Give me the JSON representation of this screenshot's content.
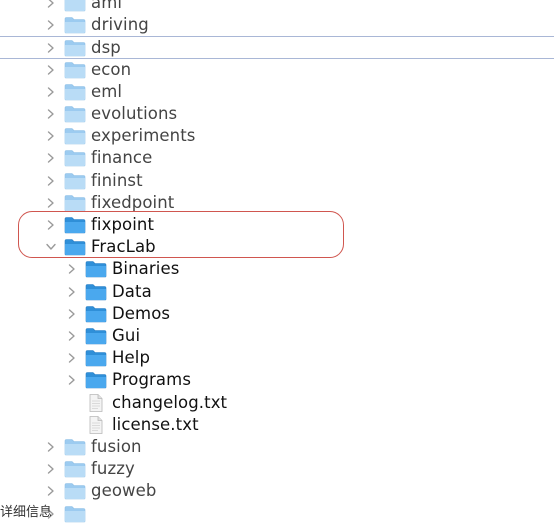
{
  "tree": {
    "items": [
      {
        "label": "aml",
        "level": 0,
        "state": "collapsed",
        "type": "folder",
        "style": "partial"
      },
      {
        "label": "driving",
        "level": 0,
        "state": "collapsed",
        "type": "folder",
        "style": "normal"
      },
      {
        "label": "dsp",
        "level": 0,
        "state": "collapsed",
        "type": "folder",
        "style": "normal"
      },
      {
        "label": "econ",
        "level": 0,
        "state": "collapsed",
        "type": "folder",
        "style": "normal"
      },
      {
        "label": "eml",
        "level": 0,
        "state": "collapsed",
        "type": "folder",
        "style": "normal"
      },
      {
        "label": "evolutions",
        "level": 0,
        "state": "collapsed",
        "type": "folder",
        "style": "normal"
      },
      {
        "label": "experiments",
        "level": 0,
        "state": "collapsed",
        "type": "folder",
        "style": "normal"
      },
      {
        "label": "finance",
        "level": 0,
        "state": "collapsed",
        "type": "folder",
        "style": "normal"
      },
      {
        "label": "fininst",
        "level": 0,
        "state": "collapsed",
        "type": "folder",
        "style": "normal"
      },
      {
        "label": "fixedpoint",
        "level": 0,
        "state": "collapsed",
        "type": "folder",
        "style": "normal"
      },
      {
        "label": "fixpoint",
        "level": 0,
        "state": "collapsed",
        "type": "folder",
        "style": "strong"
      },
      {
        "label": "FracLab",
        "level": 0,
        "state": "expanded",
        "type": "folder",
        "style": "strong"
      },
      {
        "label": "Binaries",
        "level": 1,
        "state": "collapsed",
        "type": "folder",
        "style": "strong"
      },
      {
        "label": "Data",
        "level": 1,
        "state": "collapsed",
        "type": "folder",
        "style": "strong"
      },
      {
        "label": "Demos",
        "level": 1,
        "state": "collapsed",
        "type": "folder",
        "style": "strong"
      },
      {
        "label": "Gui",
        "level": 1,
        "state": "collapsed",
        "type": "folder",
        "style": "strong"
      },
      {
        "label": "Help",
        "level": 1,
        "state": "collapsed",
        "type": "folder",
        "style": "strong"
      },
      {
        "label": "Programs",
        "level": 1,
        "state": "collapsed",
        "type": "folder",
        "style": "strong"
      },
      {
        "label": "changelog.txt",
        "level": 1,
        "state": "none",
        "type": "file",
        "style": "strong"
      },
      {
        "label": "license.txt",
        "level": 1,
        "state": "none",
        "type": "file",
        "style": "strong"
      },
      {
        "label": "fusion",
        "level": 0,
        "state": "collapsed",
        "type": "folder",
        "style": "normal"
      },
      {
        "label": "fuzzy",
        "level": 0,
        "state": "collapsed",
        "type": "folder",
        "style": "normal"
      },
      {
        "label": "geoweb",
        "level": 0,
        "state": "collapsed",
        "type": "folder",
        "style": "normal"
      },
      {
        "label": "",
        "level": 0,
        "state": "collapsed",
        "type": "folder",
        "style": "normal"
      }
    ]
  },
  "footer_text": "详细信息",
  "colors": {
    "folder_light": "#a9d3f2",
    "folder_dark": "#3d9ee6",
    "annotation": "#d0564f",
    "selection_line": "#a9b7d6"
  }
}
